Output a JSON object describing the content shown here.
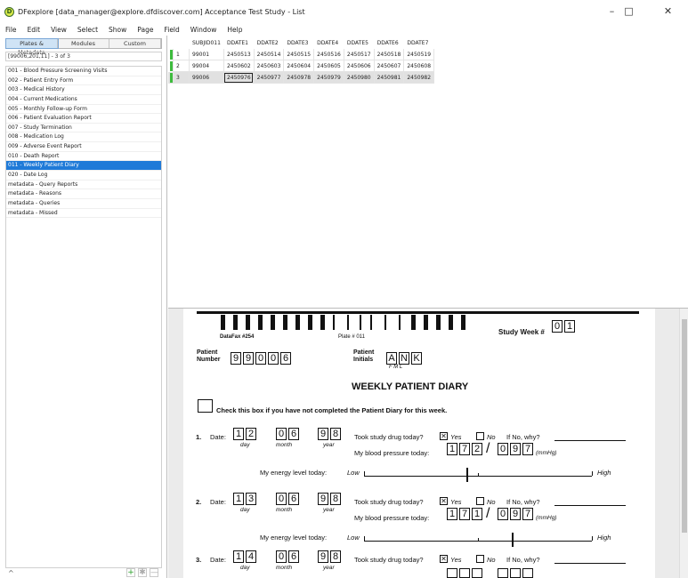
{
  "window": {
    "title": "DFexplore [data_manager@explore.dfdiscover.com] Acceptance Test Study - List",
    "icon": "dfexplore-logo",
    "controls": {
      "minimize": "–",
      "maximize": "□",
      "close": "✕"
    }
  },
  "menu": [
    "File",
    "Edit",
    "View",
    "Select",
    "Show",
    "Page",
    "Field",
    "Window",
    "Help"
  ],
  "sidebar": {
    "tabs": [
      "Plates & Metadata",
      "Modules",
      "Custom"
    ],
    "status": "[99006,201,11] - 3 of 3",
    "plates": [
      "001 - Blood Pressure Screening Visits",
      "002 - Patient Entry Form",
      "003 - Medical History",
      "004 - Current Medications",
      "005 - Monthly Follow-up Form",
      "006 - Patient Evaluation Report",
      "007 - Study Termination",
      "008 - Medication Log",
      "009 - Adverse Event Report",
      "010 - Death Report",
      "011 - Weekly Patient Diary",
      "020 - Date Log",
      "metadata - Query Reports",
      "metadata - Reasons",
      "metadata - Queries",
      "metadata - Missed"
    ],
    "selected_index": 10,
    "bottom": {
      "up_icon": "^",
      "add": "+",
      "star": "✱",
      "remove": "—"
    }
  },
  "grid": {
    "columns": [
      "SUBJID011",
      "DDATE1",
      "DDATE2",
      "DDATE3",
      "DDATE4",
      "DDATE5",
      "DDATE6",
      "DDATE7"
    ],
    "rows": [
      {
        "n": "1",
        "cells": [
          "99001",
          "2450513",
          "2450514",
          "2450515",
          "2450516",
          "2450517",
          "2450518",
          "2450519"
        ]
      },
      {
        "n": "2",
        "cells": [
          "99004",
          "2450602",
          "2450603",
          "2450604",
          "2450605",
          "2450606",
          "2450607",
          "2450608"
        ]
      },
      {
        "n": "3",
        "cells": [
          "99006",
          "2450976",
          "2450977",
          "2450978",
          "2450979",
          "2450980",
          "2450981",
          "2450982"
        ]
      }
    ],
    "selected_row": 2,
    "current_cell": [
      2,
      1
    ]
  },
  "form": {
    "datafax": "DataFax #254",
    "plate": "Plate # 011",
    "week_label": "Study Week #",
    "week": [
      "0",
      "1"
    ],
    "patient_number_label": [
      "Patient",
      "Number"
    ],
    "patient_number": [
      "9",
      "9",
      "0",
      "0",
      "6"
    ],
    "initials_label": [
      "Patient",
      "Initials"
    ],
    "initials": [
      "A",
      "N",
      "K"
    ],
    "initials_hint": "F  M  L",
    "title": "WEEKLY PATIENT DIARY",
    "not_completed": "Check this box if you have not completed the Patient Diary for this week.",
    "entries": [
      {
        "num": "1.",
        "date_label": "Date:",
        "day": [
          "1",
          "2"
        ],
        "month": [
          "0",
          "6"
        ],
        "year": [
          "9",
          "8"
        ],
        "took": "Took study drug today?",
        "yes": "Yes",
        "no": "No",
        "ifno": "If No, why?",
        "bp_label": "My blood pressure today:",
        "sys": [
          "1",
          "7",
          "2"
        ],
        "dia": [
          "0",
          "9",
          "7"
        ],
        "unit": "(mmHg)",
        "energy": "My energy level today:",
        "low": "Low",
        "high": "High",
        "energy_value": 0.45
      },
      {
        "num": "2.",
        "date_label": "Date:",
        "day": [
          "1",
          "3"
        ],
        "month": [
          "0",
          "6"
        ],
        "year": [
          "9",
          "8"
        ],
        "took": "Took study drug today?",
        "yes": "Yes",
        "no": "No",
        "ifno": "If No, why?",
        "bp_label": "My blood pressure today:",
        "sys": [
          "1",
          "7",
          "1"
        ],
        "dia": [
          "0",
          "9",
          "7"
        ],
        "unit": "(mmHg)",
        "energy": "My energy level today:",
        "low": "Low",
        "high": "High",
        "energy_value": 0.65
      },
      {
        "num": "3.",
        "date_label": "Date:",
        "day": [
          "1",
          "4"
        ],
        "month": [
          "0",
          "6"
        ],
        "year": [
          "9",
          "8"
        ],
        "took": "Took study drug today?",
        "yes": "Yes",
        "no": "No",
        "ifno": "If No, why?"
      }
    ],
    "day_label": "day",
    "month_label": "month",
    "year_label": "year"
  }
}
